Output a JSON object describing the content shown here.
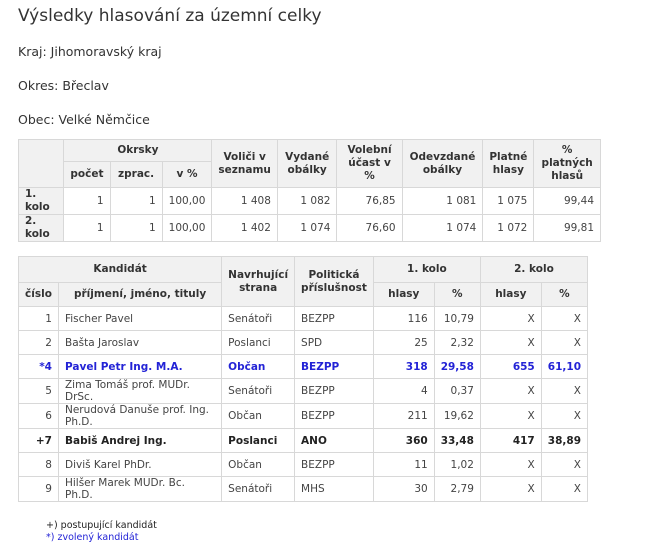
{
  "title": "Výsledky hlasování za územní celky",
  "region": "Kraj: Jihomoravský kraj",
  "district": "Okres: Břeclav",
  "municipality": "Obec: Velké Němčice",
  "summary": {
    "headers": {
      "okrsky": "Okrsky",
      "pocet": "počet",
      "zprac": "zprac.",
      "pct": "v %",
      "volici": "Voliči v seznamu",
      "vydane": "Vydané obálky",
      "ucast": "Volební účast v %",
      "odevzdane": "Odevzdané obálky",
      "platne": "Platné hlasy",
      "pct_platnych": "% platných hlasů"
    },
    "rows": [
      {
        "label": "1. kolo",
        "pocet": "1",
        "zprac": "1",
        "pct": "100,00",
        "volici": "1 408",
        "vydane": "1 082",
        "ucast": "76,85",
        "odevzdane": "1 081",
        "platne": "1 075",
        "pct_platnych": "99,44"
      },
      {
        "label": "2. kolo",
        "pocet": "1",
        "zprac": "1",
        "pct": "100,00",
        "volici": "1 402",
        "vydane": "1 074",
        "ucast": "76,60",
        "odevzdane": "1 074",
        "platne": "1 072",
        "pct_platnych": "99,81"
      }
    ]
  },
  "candidates": {
    "headers": {
      "kandidat": "Kandidát",
      "navrhujici": "Navrhující strana",
      "politicka": "Politická příslušnost",
      "kolo1": "1. kolo",
      "kolo2": "2. kolo",
      "cislo": "číslo",
      "jmeno": "příjmení, jméno, tituly",
      "hlasy": "hlasy",
      "pct": "%"
    },
    "rows": [
      {
        "cislo": "1",
        "jmeno": "Fischer Pavel",
        "strana": "Senátoři",
        "prislusnost": "BEZPP",
        "h1": "116",
        "p1": "10,79",
        "h2": "X",
        "p2": "X",
        "style": "normal"
      },
      {
        "cislo": "2",
        "jmeno": "Bašta Jaroslav",
        "strana": "Poslanci",
        "prislusnost": "SPD",
        "h1": "25",
        "p1": "2,32",
        "h2": "X",
        "p2": "X",
        "style": "normal"
      },
      {
        "cislo": "*4",
        "jmeno": "Pavel Petr Ing. M.A.",
        "strana": "Občan",
        "prislusnost": "BEZPP",
        "h1": "318",
        "p1": "29,58",
        "h2": "655",
        "p2": "61,10",
        "style": "elected"
      },
      {
        "cislo": "5",
        "jmeno": "Zima Tomáš prof. MUDr. DrSc.",
        "strana": "Senátoři",
        "prislusnost": "BEZPP",
        "h1": "4",
        "p1": "0,37",
        "h2": "X",
        "p2": "X",
        "style": "normal"
      },
      {
        "cislo": "6",
        "jmeno": "Nerudová Danuše prof. Ing. Ph.D.",
        "strana": "Občan",
        "prislusnost": "BEZPP",
        "h1": "211",
        "p1": "19,62",
        "h2": "X",
        "p2": "X",
        "style": "normal"
      },
      {
        "cislo": "+7",
        "jmeno": "Babiš Andrej Ing.",
        "strana": "Poslanci",
        "prislusnost": "ANO",
        "h1": "360",
        "p1": "33,48",
        "h2": "417",
        "p2": "38,89",
        "style": "bold"
      },
      {
        "cislo": "8",
        "jmeno": "Diviš Karel PhDr.",
        "strana": "Občan",
        "prislusnost": "BEZPP",
        "h1": "11",
        "p1": "1,02",
        "h2": "X",
        "p2": "X",
        "style": "normal"
      },
      {
        "cislo": "9",
        "jmeno": "Hilšer Marek MUDr. Bc. Ph.D.",
        "strana": "Senátoři",
        "prislusnost": "MHS",
        "h1": "30",
        "p1": "2,79",
        "h2": "X",
        "p2": "X",
        "style": "normal"
      }
    ]
  },
  "notes": {
    "advancing": "+) postupující kandidát",
    "elected": "*) zvolený kandidát"
  }
}
